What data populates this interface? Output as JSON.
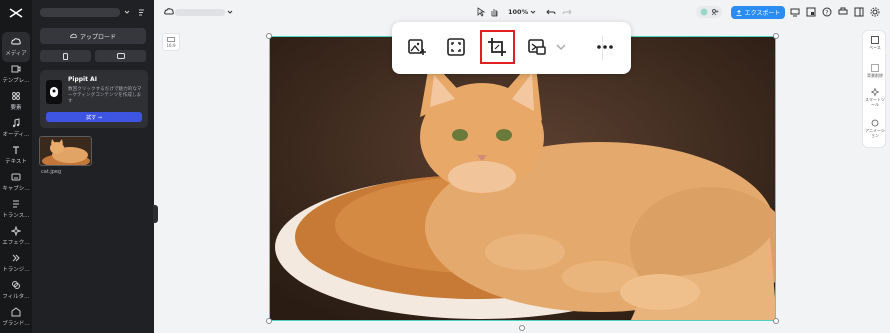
{
  "left_rail": {
    "items": [
      {
        "label": "メディア",
        "icon": "media-cloud-icon"
      },
      {
        "label": "テンプレ…",
        "icon": "template-icon"
      },
      {
        "label": "要素",
        "icon": "elements-icon"
      },
      {
        "label": "オーディ…",
        "icon": "audio-icon"
      },
      {
        "label": "テキスト",
        "icon": "text-icon"
      },
      {
        "label": "キャプシ…",
        "icon": "caption-icon"
      },
      {
        "label": "トランス…",
        "icon": "transcript-icon"
      },
      {
        "label": "エフェク…",
        "icon": "effects-icon"
      },
      {
        "label": "トランジ…",
        "icon": "transition-icon"
      },
      {
        "label": "フィルタ…",
        "icon": "filter-icon"
      },
      {
        "label": "ブランド…",
        "icon": "brand-icon"
      }
    ]
  },
  "media_panel": {
    "upload_label": "アップロード",
    "pippit": {
      "title": "Pippit AI",
      "description": "数回クリックするだけで魅力的なマーケティングコンテンツを作成します",
      "try_label": "試す →"
    },
    "file_name": "cat.jpeg"
  },
  "top_bar": {
    "zoom": "100%",
    "export_label": "エクスポート"
  },
  "page_chip": {
    "label": "16:9"
  },
  "right_rail": {
    "items": [
      {
        "label": "ベース",
        "icon": "base-icon"
      },
      {
        "label": "背景削除",
        "icon": "remove-bg-icon"
      },
      {
        "label": "スマートツール",
        "icon": "smart-tools-icon"
      },
      {
        "label": "アニメーション",
        "icon": "animation-icon"
      }
    ]
  },
  "floating_toolbar": {
    "items": [
      "image-add-icon",
      "fit-screen-icon",
      "crop-icon",
      "replace-icon",
      "chevron-down-icon",
      "more-icon"
    ]
  },
  "colors": {
    "accent": "#2a8cf0",
    "highlight": "#e02020",
    "selection": "#4fd1c5"
  }
}
